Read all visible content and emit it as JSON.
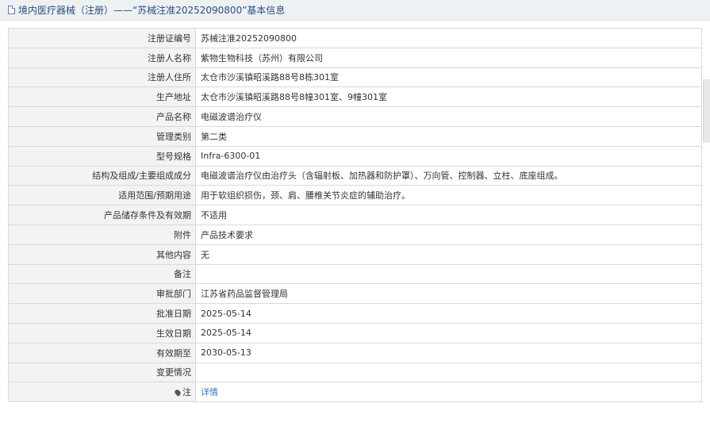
{
  "header": {
    "title": "境内医疗器械（注册）——“苏械注准20252090800”基本信息"
  },
  "rows": [
    {
      "label": "注册证编号",
      "value": "苏械注准20252090800"
    },
    {
      "label": "注册人名称",
      "value": "紫物生物科技（苏州）有限公司"
    },
    {
      "label": "注册人住所",
      "value": "太仓市沙溪镇昭溪路88号8栋301室"
    },
    {
      "label": "生产地址",
      "value": "太仓市沙溪镇昭溪路88号8幢301室、9幢301室"
    },
    {
      "label": "产品名称",
      "value": "电磁波谱治疗仪"
    },
    {
      "label": "管理类别",
      "value": "第二类"
    },
    {
      "label": "型号规格",
      "value": "Infra-6300-01"
    },
    {
      "label": "结构及组成/主要组成成分",
      "value": "电磁波谱治疗仪由治疗头（含辐射板、加热器和防护罩）、万向管、控制器、立柱、底座组成。"
    },
    {
      "label": "适用范围/预期用途",
      "value": "用于软组织损伤，颈、肩、腰椎关节炎症的辅助治疗。"
    },
    {
      "label": "产品储存条件及有效期",
      "value": "不适用"
    },
    {
      "label": "附件",
      "value": "产品技术要求"
    },
    {
      "label": "其他内容",
      "value": "无"
    },
    {
      "label": "备注",
      "value": ""
    },
    {
      "label": "审批部门",
      "value": "江苏省药品监督管理局"
    },
    {
      "label": "批准日期",
      "value": "2025-05-14"
    },
    {
      "label": "生效日期",
      "value": "2025-05-14"
    },
    {
      "label": "有效期至",
      "value": "2030-05-13"
    },
    {
      "label": "变更情况",
      "value": ""
    }
  ],
  "note_row": {
    "label": "注",
    "link": "详情"
  }
}
